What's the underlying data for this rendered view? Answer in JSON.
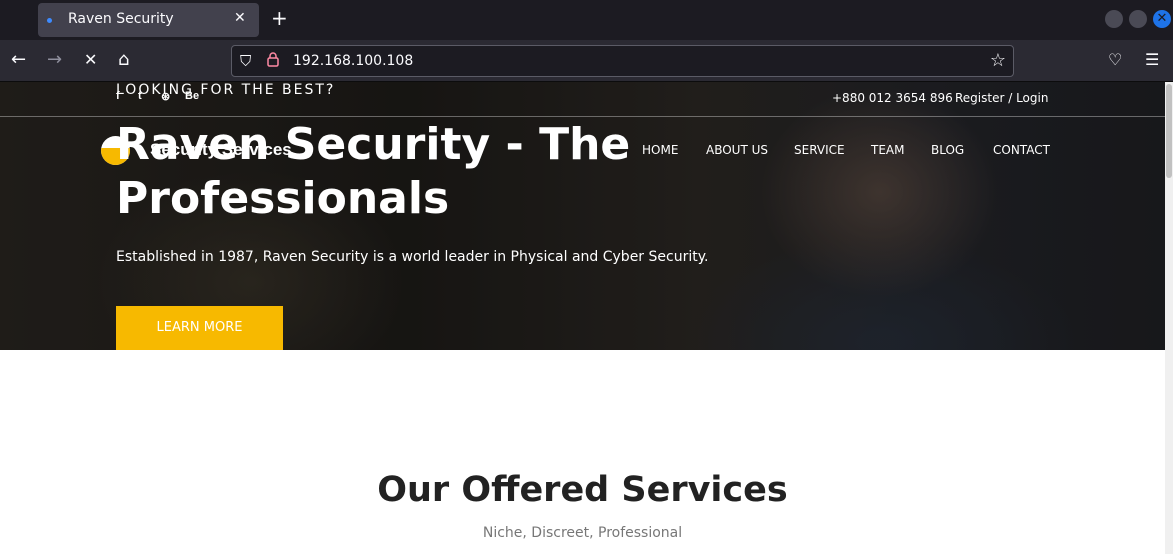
{
  "browser": {
    "tab": {
      "title": "Raven Security",
      "close_glyph": "✕"
    },
    "new_tab_glyph": "+",
    "url": "192.168.100.108",
    "icons": {
      "back": "←",
      "forward": "→",
      "stop": "✕",
      "home": "⌂",
      "shield": "⛉",
      "lock": "🔒",
      "star": "☆",
      "pocket": "♡",
      "menu": "☰"
    }
  },
  "topbar": {
    "social": [
      "f",
      "t",
      "⊛",
      "Be"
    ],
    "phone": "+880 012 3654 896",
    "auth": "Register / Login"
  },
  "header": {
    "logo_text": "Security Services",
    "menu": [
      "HOME",
      "ABOUT US",
      "SERVICE",
      "TEAM",
      "BLOG",
      "CONTACT"
    ]
  },
  "hero": {
    "kicker": "LOOKING FOR THE BEST?",
    "headline": "Raven Security - The Professionals",
    "subline": "Established in 1987, Raven Security is a world leader in Physical and Cyber Security.",
    "cta_label": "LEARN MORE"
  },
  "services": {
    "title": "Our Offered Services",
    "subtitle": "Niche, Discreet, Professional"
  },
  "colors": {
    "accent": "#f7b900",
    "chrome_dark": "#1c1b22",
    "chrome_toolbar": "#2b2a33"
  }
}
